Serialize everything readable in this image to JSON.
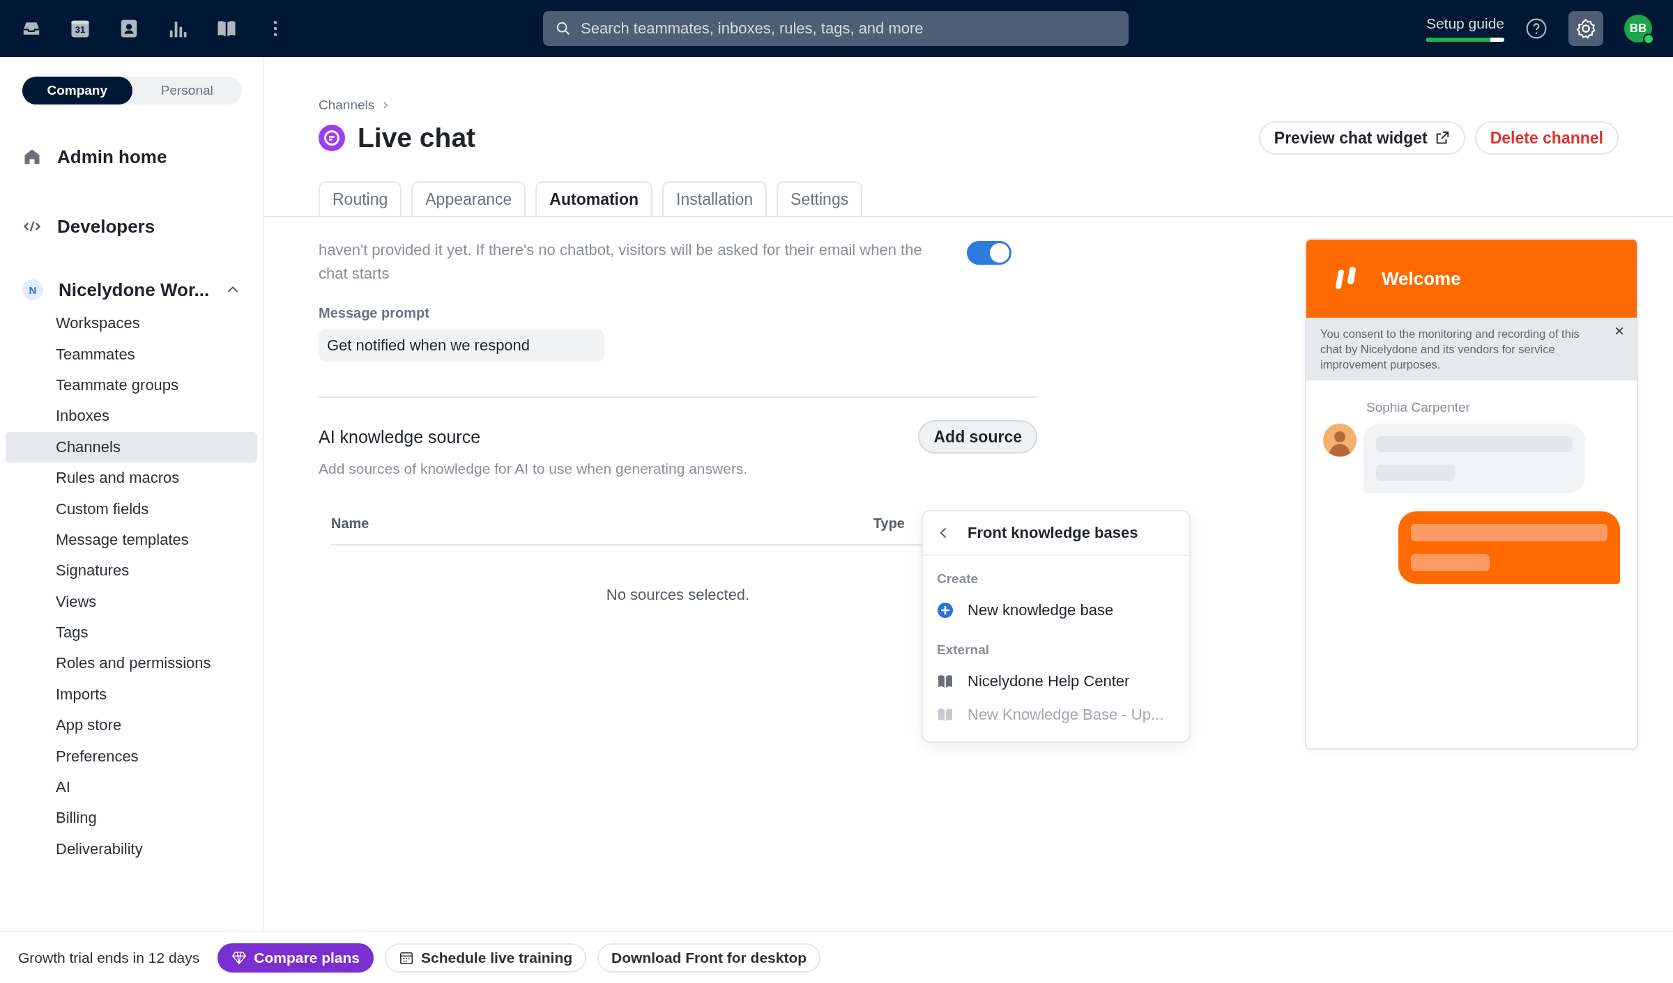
{
  "topbar": {
    "calendar_day": "31",
    "search": {
      "placeholder": "Search teammates, inboxes, rules, tags, and more"
    },
    "setup_guide": {
      "label": "Setup guide",
      "level": 0.82
    },
    "settings": {
      "selected": true
    },
    "avatar": {
      "initials": "BB",
      "online": true
    }
  },
  "sidebar": {
    "scope": [
      {
        "label": "Company",
        "selected": true
      },
      {
        "label": "Personal",
        "selected": false
      }
    ],
    "sections": [
      {
        "kind": "home",
        "label": "Admin home"
      },
      {
        "kind": "code",
        "label": "Developers"
      }
    ],
    "workspace": {
      "badge": "N",
      "name": "Nicelydone Wor...",
      "expanded": true,
      "items": [
        {
          "label": "Workspaces",
          "selected": false
        },
        {
          "label": "Teammates",
          "selected": false
        },
        {
          "label": "Teammate groups",
          "selected": false
        },
        {
          "label": "Inboxes",
          "selected": false
        },
        {
          "label": "Channels",
          "selected": true
        },
        {
          "label": "Rules and macros",
          "selected": false
        },
        {
          "label": "Custom fields",
          "selected": false
        },
        {
          "label": "Message templates",
          "selected": false
        },
        {
          "label": "Signatures",
          "selected": false
        },
        {
          "label": "Views",
          "selected": false
        },
        {
          "label": "Tags",
          "selected": false
        },
        {
          "label": "Roles and permissions",
          "selected": false
        },
        {
          "label": "Imports",
          "selected": false
        },
        {
          "label": "App store",
          "selected": false
        },
        {
          "label": "Preferences",
          "selected": false
        },
        {
          "label": "AI",
          "selected": false
        },
        {
          "label": "Billing",
          "selected": false
        },
        {
          "label": "Deliverability",
          "selected": false
        }
      ]
    }
  },
  "page": {
    "breadcrumb": "Channels",
    "title": "Live chat",
    "actions": [
      {
        "label": "Preview chat widget",
        "kind": "external"
      },
      {
        "label": "Delete channel",
        "kind": "danger"
      }
    ],
    "tabs": [
      {
        "label": "Routing",
        "selected": false
      },
      {
        "label": "Appearance",
        "selected": false
      },
      {
        "label": "Automation",
        "selected": true
      },
      {
        "label": "Installation",
        "selected": false
      },
      {
        "label": "Settings",
        "selected": false
      }
    ],
    "email_setting": {
      "description": "haven't provided it yet. If there's no chatbot, visitors will be asked for their email when the chat starts",
      "on": true
    },
    "message_prompt": {
      "label": "Message prompt",
      "value": "Get notified when we respond"
    },
    "ai_knowledge": {
      "title": "AI knowledge source",
      "subtitle": "Add sources of knowledge for AI to use when generating answers.",
      "add_button": "Add source",
      "columns": [
        "Name",
        "Type"
      ],
      "empty": "No sources selected."
    },
    "dropdown": {
      "title": "Front knowledge bases",
      "groups": [
        {
          "label": "Create",
          "items": [
            {
              "label": "New knowledge base",
              "kind": "create",
              "disabled": false
            }
          ]
        },
        {
          "label": "External",
          "items": [
            {
              "label": "Nicelydone Help Center",
              "kind": "book",
              "disabled": false
            },
            {
              "label": "New Knowledge Base - Up...",
              "kind": "book",
              "disabled": true
            }
          ]
        }
      ]
    },
    "chat_preview": {
      "header": "Welcome",
      "consent": "You consent to the monitoring and recording of this chat by Nicelydone and its vendors for service improvement purposes.",
      "agent": "Sophia Carpenter"
    }
  },
  "footer": {
    "trial": "Growth trial ends in 12 days",
    "buttons": [
      {
        "label": "Compare plans",
        "kind": "primary"
      },
      {
        "label": "Schedule live training",
        "kind": "calendar"
      },
      {
        "label": "Download Front for desktop",
        "kind": "plain"
      }
    ]
  }
}
